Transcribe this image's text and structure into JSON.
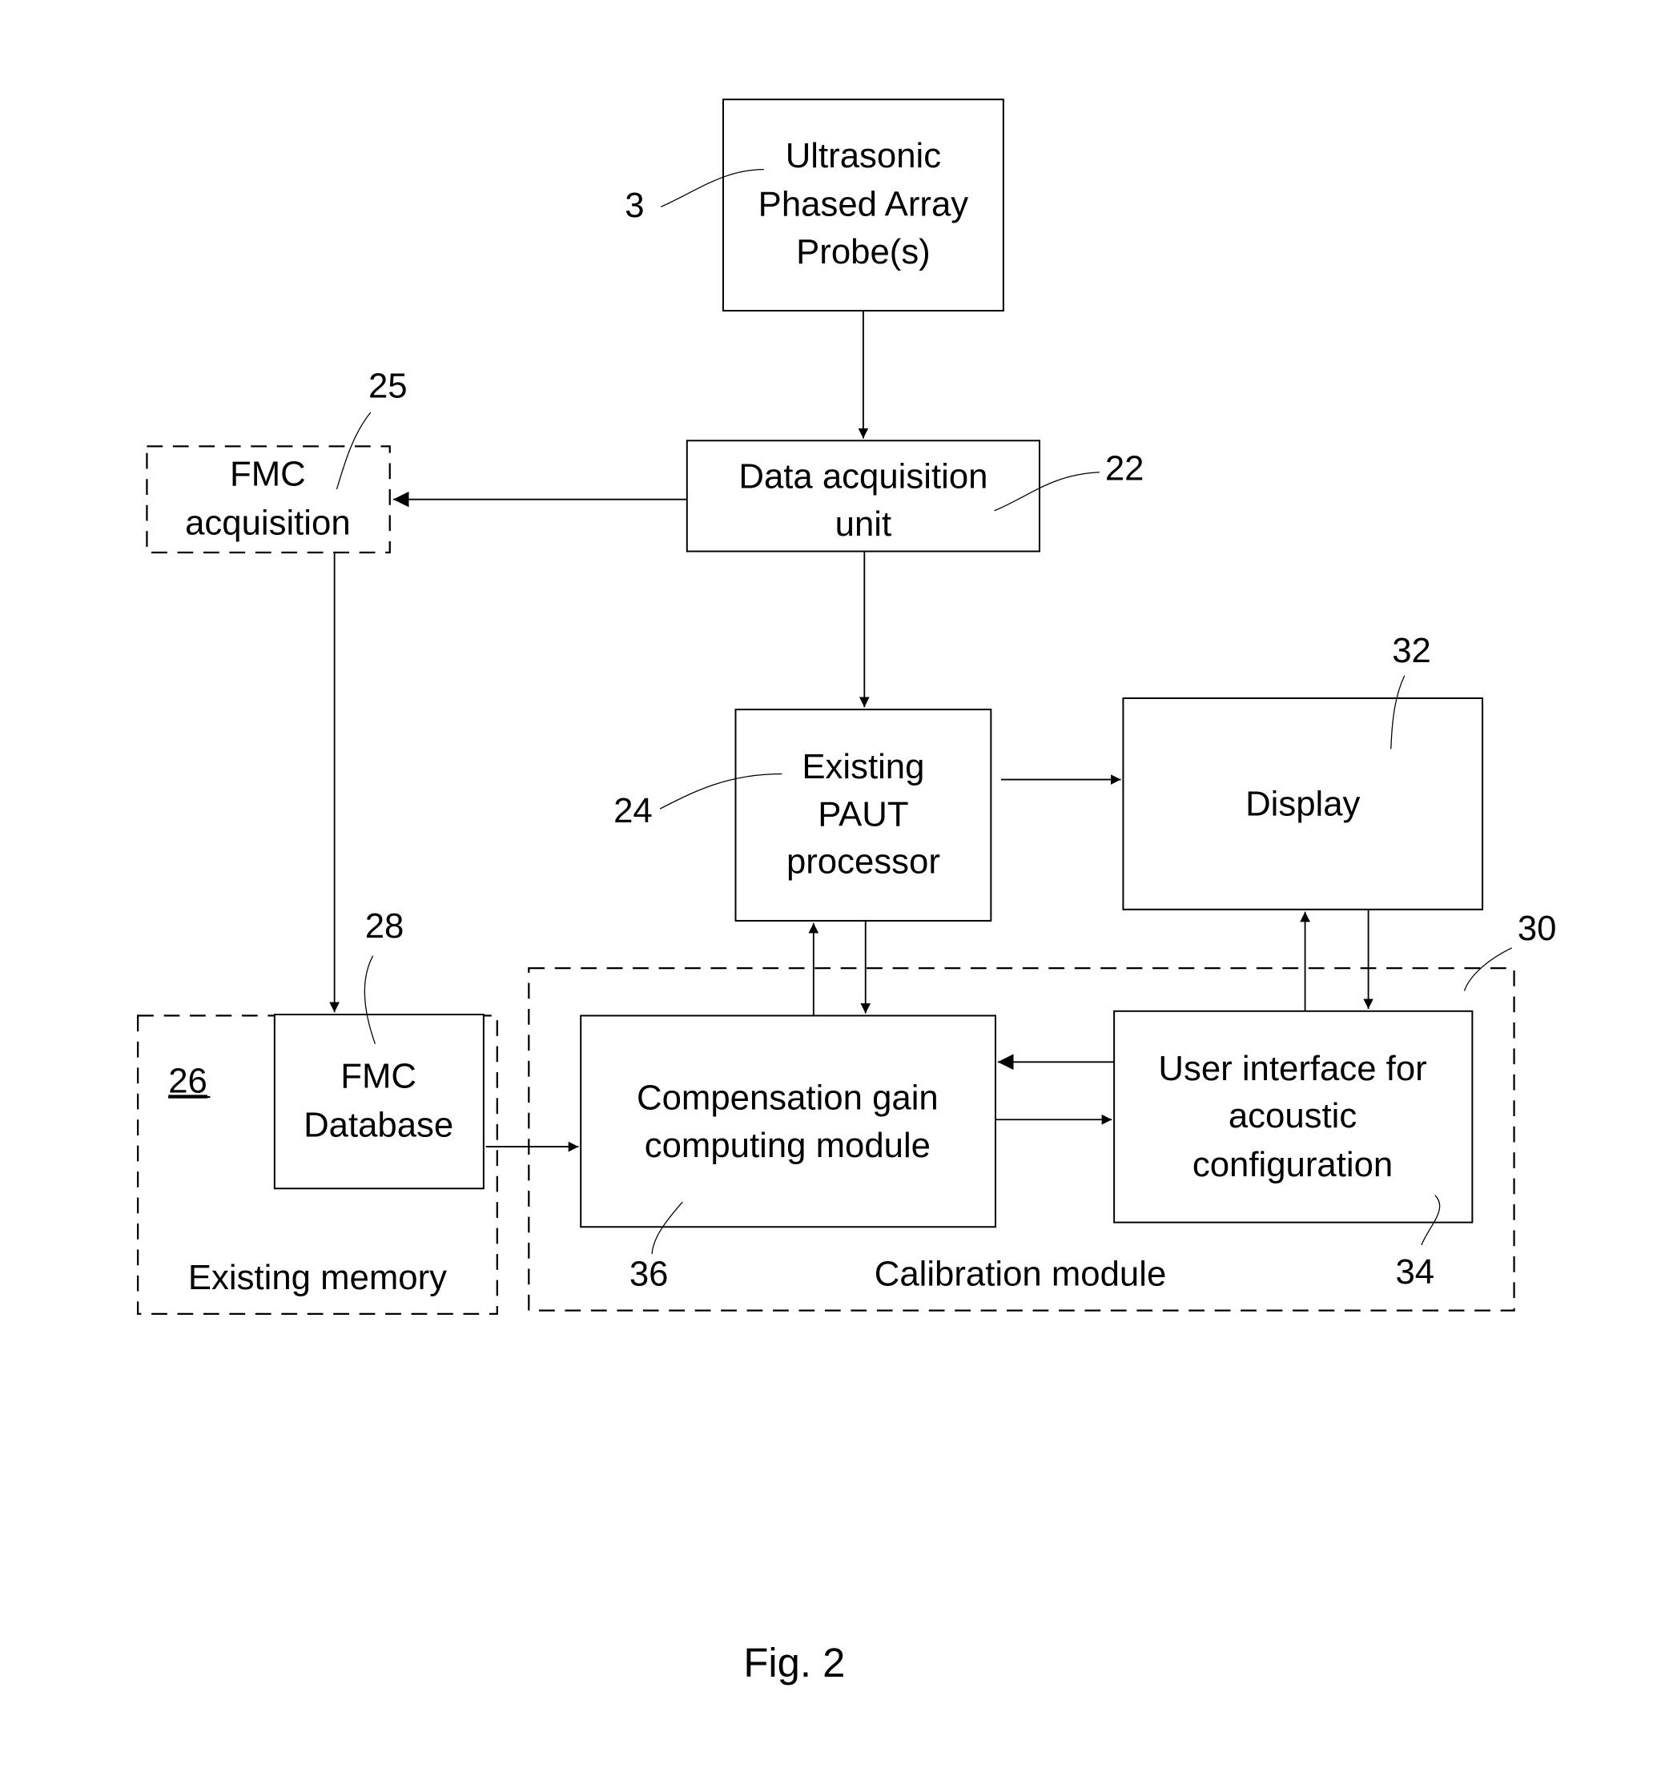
{
  "figure": {
    "caption": "Fig. 2",
    "blocks": {
      "probe": {
        "ref": "3",
        "lines": [
          "Ultrasonic",
          "Phased Array",
          "Probe(s)"
        ]
      },
      "daq": {
        "ref": "22",
        "lines": [
          "Data acquisition",
          "unit"
        ]
      },
      "fmc_acq": {
        "ref": "25",
        "lines": [
          "FMC",
          "acquisition"
        ]
      },
      "paut": {
        "ref": "24",
        "lines": [
          "Existing",
          "PAUT",
          "processor"
        ]
      },
      "display": {
        "ref": "32",
        "lines": [
          "Display"
        ]
      },
      "fmc_db": {
        "ref": "28",
        "lines": [
          "FMC",
          "Database"
        ]
      },
      "memory": {
        "ref": "26",
        "label": "Existing memory"
      },
      "calibration": {
        "ref": "30",
        "label": "Calibration module"
      },
      "comp_gain": {
        "ref": "36",
        "lines": [
          "Compensation gain",
          "computing module"
        ]
      },
      "ui": {
        "ref": "34",
        "lines": [
          "User interface for",
          "acoustic",
          "configuration"
        ]
      }
    },
    "connections": [
      {
        "from": "probe",
        "to": "daq"
      },
      {
        "from": "daq",
        "to": "fmc_acq"
      },
      {
        "from": "daq",
        "to": "paut"
      },
      {
        "from": "fmc_acq",
        "to": "fmc_db"
      },
      {
        "from": "paut",
        "to": "display"
      },
      {
        "from": "comp_gain",
        "to": "paut"
      },
      {
        "from": "paut",
        "to": "comp_gain"
      },
      {
        "from": "fmc_db",
        "to": "comp_gain"
      },
      {
        "from": "ui",
        "to": "comp_gain"
      },
      {
        "from": "comp_gain",
        "to": "ui"
      },
      {
        "from": "ui",
        "to": "display"
      },
      {
        "from": "display",
        "to": "ui"
      }
    ]
  }
}
